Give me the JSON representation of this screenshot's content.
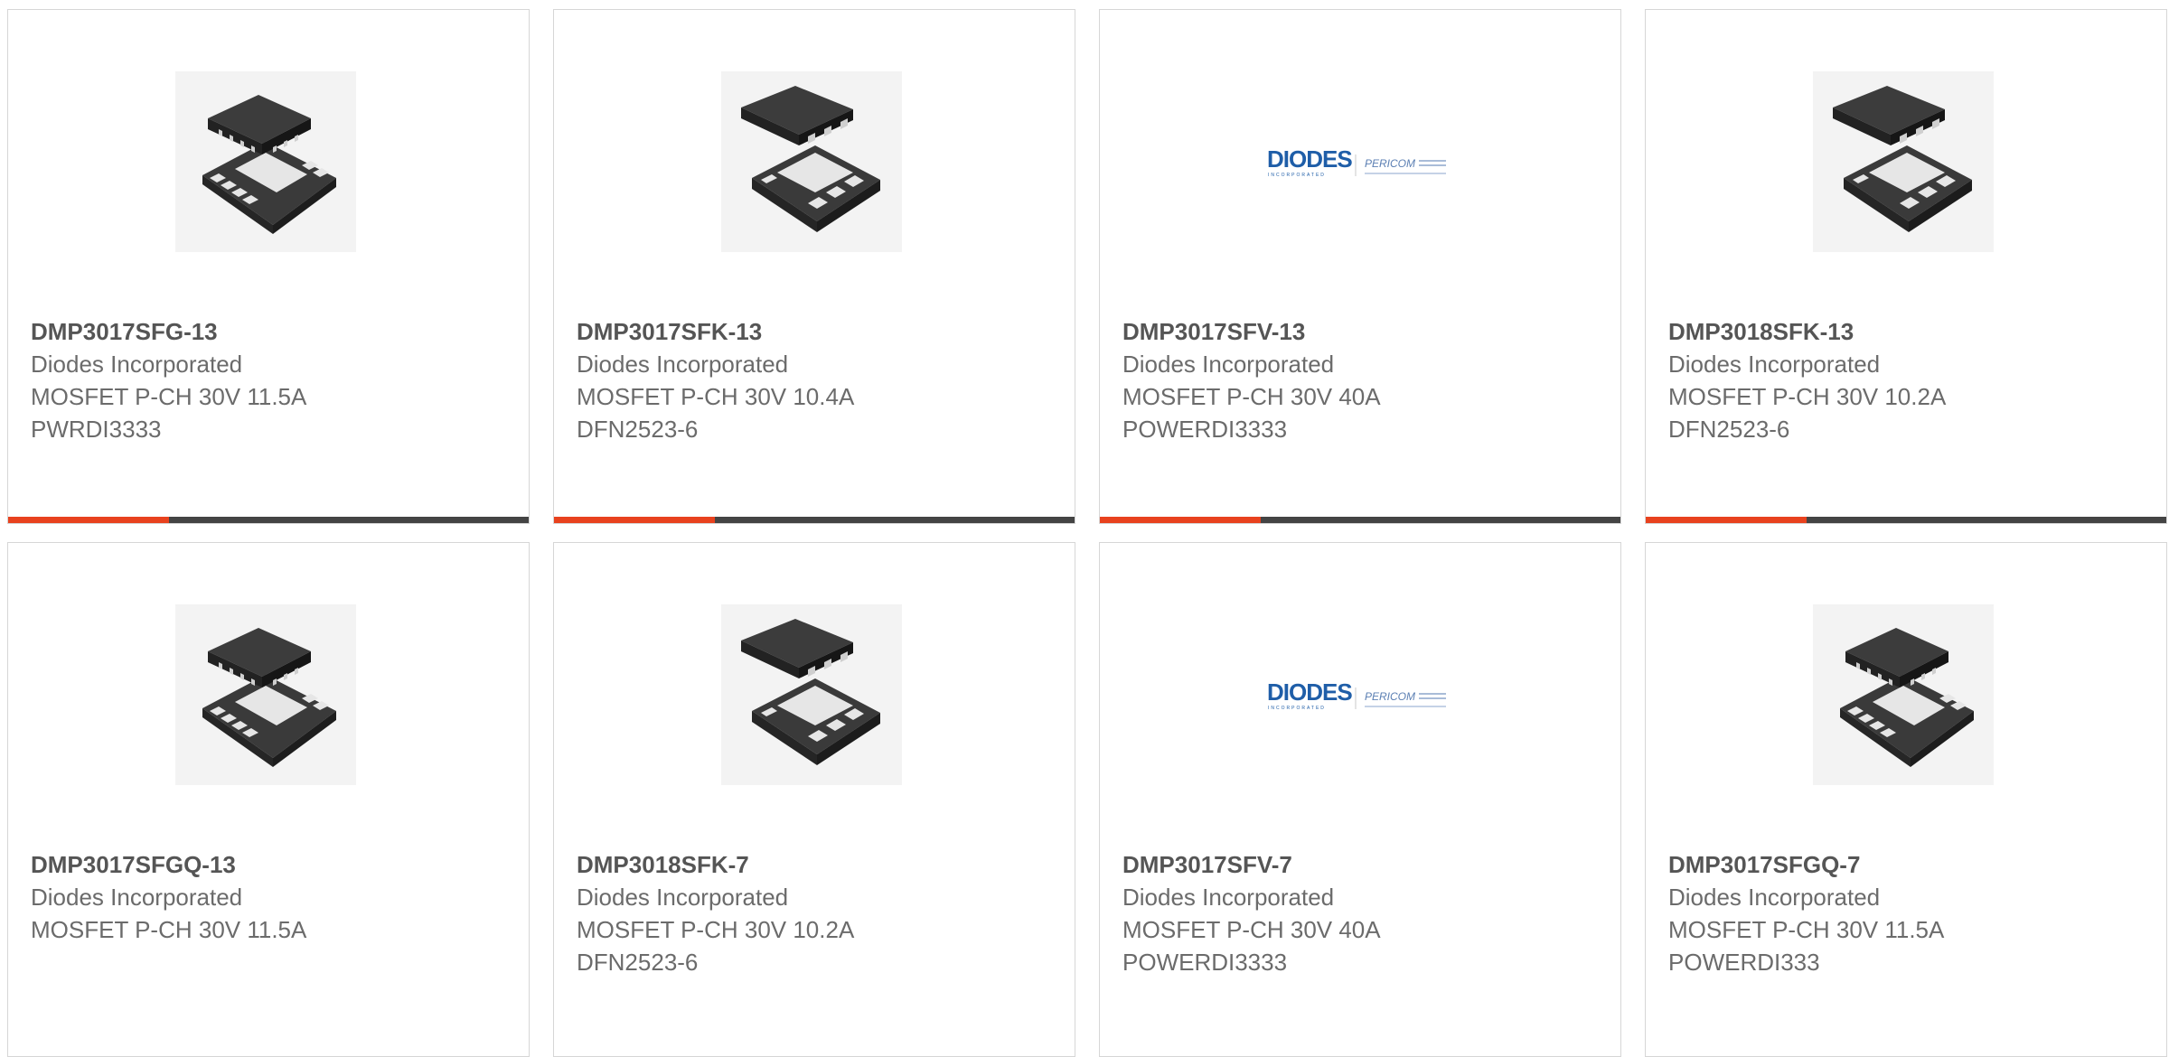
{
  "products": [
    {
      "part_number": "DMP3017SFG-13",
      "manufacturer": "Diodes Incorporated",
      "description": "MOSFET P-CH 30V 11.5A",
      "package": "PWRDI3333",
      "image": "chip-8pin-icon",
      "progress_fraction": 0.31
    },
    {
      "part_number": "DMP3017SFK-13",
      "manufacturer": "Diodes Incorporated",
      "description": "MOSFET P-CH 30V 10.4A",
      "package": "DFN2523-6",
      "image": "chip-6pin-icon",
      "progress_fraction": 0.31
    },
    {
      "part_number": "DMP3017SFV-13",
      "manufacturer": "Diodes Incorporated",
      "description": "MOSFET P-CH 30V 40A",
      "package": "POWERDI3333",
      "image": "diodes-logo",
      "logo_text": "DIODES",
      "logo_subtext": "INCORPORATED",
      "logo_text2": "PERICOM",
      "progress_fraction": 0.31
    },
    {
      "part_number": "DMP3018SFK-13",
      "manufacturer": "Diodes Incorporated",
      "description": "MOSFET P-CH 30V 10.2A",
      "package": "DFN2523-6",
      "image": "chip-6pin-icon",
      "progress_fraction": 0.31
    },
    {
      "part_number": "DMP3017SFGQ-13",
      "manufacturer": "Diodes Incorporated",
      "description": "MOSFET P-CH 30V 11.5A",
      "package": "",
      "image": "chip-8pin-icon"
    },
    {
      "part_number": "DMP3018SFK-7",
      "manufacturer": "Diodes Incorporated",
      "description": "MOSFET P-CH 30V 10.2A",
      "package": "DFN2523-6",
      "image": "chip-6pin-icon"
    },
    {
      "part_number": "DMP3017SFV-7",
      "manufacturer": "Diodes Incorporated",
      "description": "MOSFET P-CH 30V 40A",
      "package": "POWERDI3333",
      "image": "diodes-logo",
      "logo_text": "DIODES",
      "logo_subtext": "INCORPORATED",
      "logo_text2": "PERICOM"
    },
    {
      "part_number": "DMP3017SFGQ-7",
      "manufacturer": "Diodes Incorporated",
      "description": "MOSFET P-CH 30V 11.5A",
      "package": "POWERDI333",
      "image": "chip-8pin-icon"
    }
  ],
  "colors": {
    "accent": "#e8421e",
    "bar": "#444444",
    "border": "#d6d6d6",
    "text": "#6b6b6b",
    "logo_blue": "#1f5ea8"
  }
}
